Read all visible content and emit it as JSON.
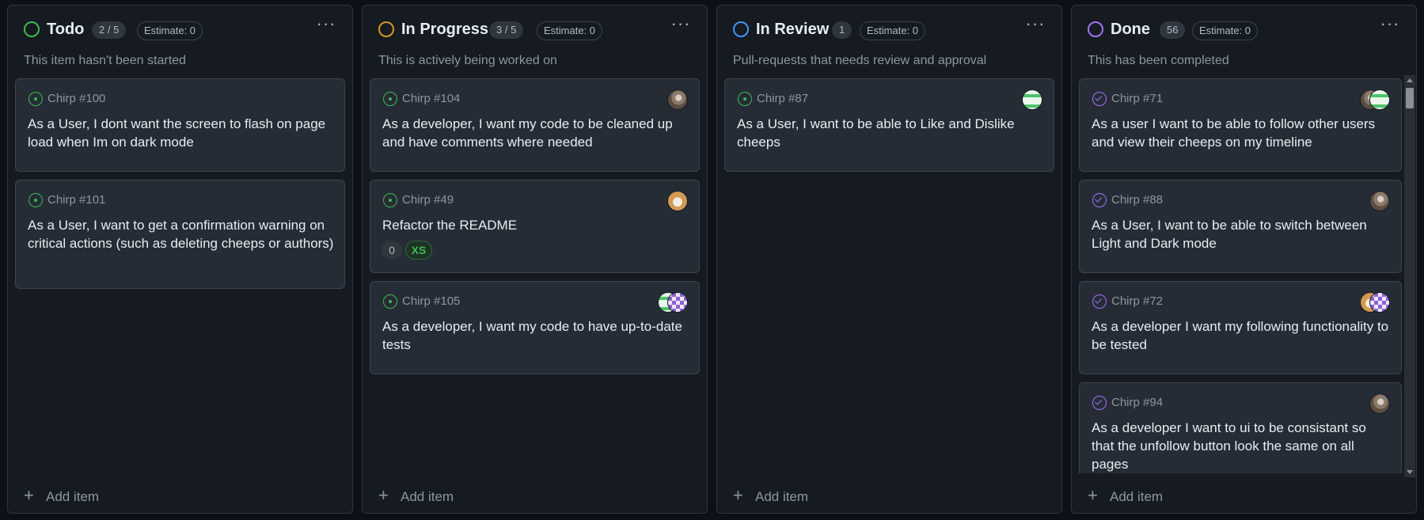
{
  "columns": [
    {
      "title": "Todo",
      "count": "2 / 5",
      "estimate": "Estimate: 0",
      "description": "This item hasn't been started",
      "status_color": "#3fb950",
      "add_label": "Add item",
      "cards": [
        {
          "ref": "Chirp #100",
          "title": "As a User, I dont want the screen to flash on page load when Im on dark mode",
          "state": "open",
          "assignees": []
        },
        {
          "ref": "Chirp #101",
          "title": "As a User, I want to get a confirmation warning on critical actions (such as deleting cheeps or authors)",
          "state": "open",
          "assignees": []
        }
      ]
    },
    {
      "title": "In Progress",
      "count": "3 / 5",
      "estimate": "Estimate: 0",
      "description": "This is actively being worked on",
      "status_color": "#d29922",
      "add_label": "Add item",
      "cards": [
        {
          "ref": "Chirp #104",
          "title": "As a developer, I want my code to be cleaned up and have comments where needed",
          "state": "open",
          "assignees": [
            "photo-avatar"
          ]
        },
        {
          "ref": "Chirp #49",
          "title": "Refactor the README",
          "state": "open",
          "assignees": [
            "orange-avatar"
          ],
          "chips": {
            "count": "0",
            "size": "XS"
          }
        },
        {
          "ref": "Chirp #105",
          "title": "As a developer, I want my code to have up-to-date tests",
          "state": "open",
          "assignees": [
            "green-avatar",
            "purple-avatar"
          ]
        }
      ]
    },
    {
      "title": "In Review",
      "count": "1",
      "estimate": "Estimate: 0",
      "description": "Pull-requests that needs review and approval",
      "status_color": "#4493f8",
      "add_label": "Add item",
      "cards": [
        {
          "ref": "Chirp #87",
          "title": "As a User, I want to be able to Like and Dislike cheeps",
          "state": "open",
          "assignees": [
            "green-avatar"
          ]
        }
      ]
    },
    {
      "title": "Done",
      "count": "56",
      "estimate": "Estimate: 0",
      "description": "This has been completed",
      "status_color": "#a371f7",
      "add_label": "Add item",
      "cards": [
        {
          "ref": "Chirp #71",
          "title": "As a user I want to be able to follow other users and view their cheeps on my timeline",
          "state": "done",
          "assignees": [
            "photo-avatar",
            "green-avatar"
          ]
        },
        {
          "ref": "Chirp #88",
          "title": "As a User, I want to be able to switch between Light and Dark mode",
          "state": "done",
          "assignees": [
            "photo-avatar"
          ]
        },
        {
          "ref": "Chirp #72",
          "title": "As a developer I want my following functionality to be tested",
          "state": "done",
          "assignees": [
            "orange-avatar",
            "purple-avatar"
          ]
        },
        {
          "ref": "Chirp #94",
          "title": "As a developer I want to ui to be consistant so that the unfollow button look the same on all pages",
          "state": "done",
          "assignees": [
            "photo-avatar"
          ]
        }
      ]
    }
  ],
  "more_icon": "kebab-horizontal-icon"
}
